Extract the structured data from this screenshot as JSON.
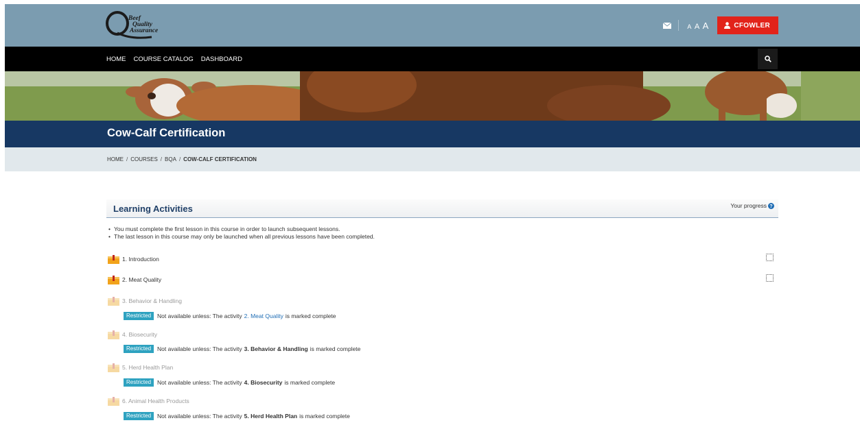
{
  "header": {
    "logo_lines": [
      "Beef",
      "Quality",
      "Assurance"
    ],
    "logo_letter": "Q",
    "font_size_label": [
      "A",
      "A",
      "A"
    ],
    "user_button": "CFOWLER",
    "accent_color": "#e2231a",
    "icons": {
      "mail": "envelope-icon",
      "user": "person-icon",
      "search": "search-icon"
    }
  },
  "nav": {
    "items": [
      "HOME",
      "COURSE CATALOG",
      "DASHBOARD"
    ]
  },
  "course": {
    "title": "Cow-Calf Certification"
  },
  "breadcrumb": {
    "items": [
      "HOME",
      "COURSES",
      "BQA"
    ],
    "current": "COW-CALF CERTIFICATION",
    "separator": "/"
  },
  "learning": {
    "title": "Learning Activities",
    "progress_label": "Your progress",
    "notes": [
      "You must complete the first lesson in this course in order to launch subsequent lessons.",
      "The last lesson in this course may only be launched when all previous lessons have been completed."
    ],
    "activities": [
      {
        "label": "1. Introduction",
        "enabled": true
      },
      {
        "label": "2. Meat Quality",
        "enabled": true
      },
      {
        "label": "3. Behavior & Handling",
        "enabled": false,
        "restriction": {
          "badge": "Restricted",
          "prefix": "Not available unless: The activity",
          "ref": "2. Meat Quality",
          "suffix": "is marked complete",
          "ref_is_link": true
        }
      },
      {
        "label": "4. Biosecurity",
        "enabled": false,
        "restriction": {
          "badge": "Restricted",
          "prefix": "Not available unless: The activity",
          "ref": "3. Behavior & Handling",
          "suffix": "is marked complete",
          "ref_is_link": false
        }
      },
      {
        "label": "5. Herd Health Plan",
        "enabled": false,
        "restriction": {
          "badge": "Restricted",
          "prefix": "Not available unless: The activity",
          "ref": "4. Biosecurity",
          "suffix": "is marked complete",
          "ref_is_link": false
        }
      },
      {
        "label": "6. Animal Health Products",
        "enabled": false,
        "restriction": {
          "badge": "Restricted",
          "prefix": "Not available unless: The activity",
          "ref": "5. Herd Health Plan",
          "suffix": "is marked complete",
          "ref_is_link": false
        }
      }
    ]
  }
}
